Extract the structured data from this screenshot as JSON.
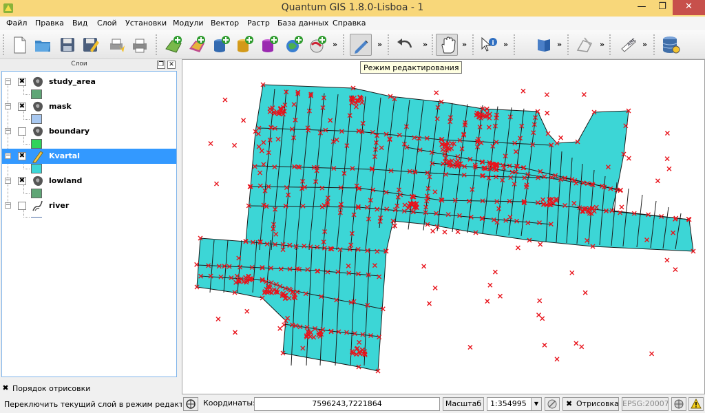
{
  "window": {
    "title": "Quantum GIS 1.8.0-Lisboa - 1",
    "min": "—",
    "max": "❐",
    "close": "✕"
  },
  "menu": [
    "Файл",
    "Правка",
    "Вид",
    "Слой",
    "Установки",
    "Модули",
    "Вектор",
    "Растр",
    "База данных",
    "Справка"
  ],
  "toolbar": {
    "more": "»",
    "buttons": [
      "new-project-icon",
      "open-project-icon",
      "save-project-icon",
      "save-as-icon",
      "print-composer-icon",
      "print-icon",
      "add-vector-icon",
      "add-raster-icon",
      "add-postgis-icon",
      "add-spatialite-icon",
      "add-mssql-icon",
      "add-wms-icon",
      "add-wfs-icon",
      "toggle-editing-icon",
      "undo-icon",
      "pan-icon",
      "identify-icon",
      "help-icon",
      "digitize-icon",
      "label-icon",
      "db-manager-icon"
    ]
  },
  "tooltip": "Режим редактирования",
  "layers_panel": {
    "title": "Слои",
    "float_btn": "❐",
    "close_btn": "✕",
    "layers": [
      {
        "name": "study_area",
        "checked": true,
        "selected": false,
        "swatch": "#5fa676"
      },
      {
        "name": "mask",
        "checked": true,
        "selected": false,
        "swatch": "#a8c8f0"
      },
      {
        "name": "boundary",
        "checked": false,
        "selected": false,
        "swatch": "#2fd35a"
      },
      {
        "name": "Kvartal",
        "checked": true,
        "selected": true,
        "swatch": "#3cd6d6"
      },
      {
        "name": "lowland",
        "checked": true,
        "selected": false,
        "swatch": "#5fa676"
      },
      {
        "name": "river",
        "checked": false,
        "selected": false,
        "swatch": "#4a6aa5"
      }
    ],
    "expander": "−",
    "check_mark": "✖"
  },
  "render_order": {
    "checked": "✖",
    "label": "Порядок отрисовки"
  },
  "status": {
    "message": "Переключить текущий слой в режим редактирования",
    "coord_label": "Координаты:",
    "coord_value": "7596243,7221864",
    "scale_label": "Масштаб",
    "scale_value": "1:354995",
    "render_check": "✖",
    "render_label": "Отрисовка",
    "epsg": "EPSG:20007"
  },
  "colors": {
    "fill": "#3cd6d6",
    "vertex": "#e8141c",
    "edge": "#1a1a1a",
    "selected": "#3399ff",
    "titlebar": "#f8d77a"
  }
}
